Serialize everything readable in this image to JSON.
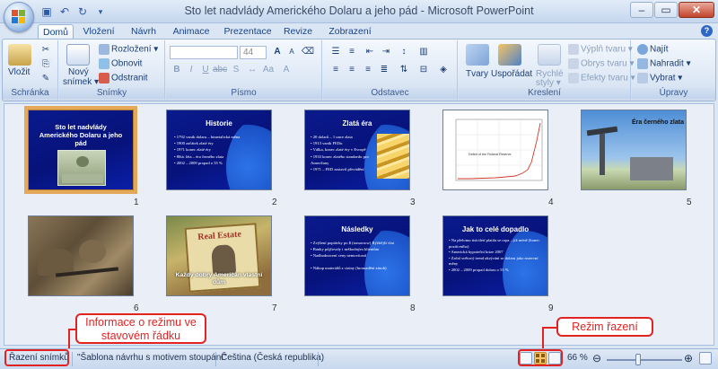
{
  "window": {
    "title": "Sto let nadvlády Amerického Dolaru a jeho pád - Microsoft PowerPoint"
  },
  "tabs": [
    {
      "label": "Domů",
      "active": true
    },
    {
      "label": "Vložení",
      "active": false
    },
    {
      "label": "Návrh",
      "active": false
    },
    {
      "label": "Animace",
      "active": false
    },
    {
      "label": "Prezentace",
      "active": false
    },
    {
      "label": "Revize",
      "active": false
    },
    {
      "label": "Zobrazení",
      "active": false
    }
  ],
  "ribbon": {
    "clipboard": {
      "label": "Schránka",
      "paste": "Vložit"
    },
    "slides": {
      "label": "Snímky",
      "new_slide_1": "Nový",
      "new_slide_2": "snímek ▾",
      "layout": "Rozložení ▾",
      "reset": "Obnovit",
      "delete": "Odstranit"
    },
    "font": {
      "label": "Písmo",
      "size": "44"
    },
    "paragraph": {
      "label": "Odstavec"
    },
    "drawing": {
      "label": "Kreslení",
      "shapes": "Tvary",
      "arrange": "Uspořádat",
      "quick_styles_1": "Rychlé",
      "quick_styles_2": "styly ▾",
      "shape_fill": "Výplň tvaru ▾",
      "shape_outline": "Obrys tvaru ▾",
      "shape_effects": "Efekty tvaru ▾"
    },
    "editing": {
      "label": "Úpravy",
      "find": "Najít",
      "replace": "Nahradit ▾",
      "select": "Vybrat ▾"
    }
  },
  "slides": [
    {
      "num": "1",
      "title": "Sto let nadvlády Amerického Dolaru a jeho pád",
      "selected": true
    },
    {
      "num": "2",
      "title": "Historie",
      "bullets": [
        "1792 vznik dolaru – bimetalická měna",
        "1900 začátek zlaté éry",
        "1971 konec zlaté éry",
        "80tá. léta – éra černého zlata",
        "2002 – 2009 propad o 55 %"
      ]
    },
    {
      "num": "3",
      "title": "Zlatá éra",
      "bullets": [
        "20 dolarů – 1 unce zlata",
        "1913 vznik FEDu",
        "Válka, konec zlaté éry v Evropě",
        "1933 konec zlatého standardu pro Američany",
        "1971 – FED zastavil převádění"
      ]
    },
    {
      "num": "4",
      "chart_caption": "Deficit of the Federal Reserve"
    },
    {
      "num": "5",
      "title": "Éra černého zlata"
    },
    {
      "num": "6"
    },
    {
      "num": "7",
      "title": "Každý dobrý Američan vlastní dům",
      "sign_text": "Real Estate"
    },
    {
      "num": "8",
      "title": "Následky",
      "bullets": [
        "Zvýšení poptávky po $ (tomorrow) Rýžitější vlni",
        "Banky půjčovaly i neškodným klientům",
        "Nadhodnocení ceny nemovitostí",
        "Nákup materiálů z ciziny (hromadění zásob)"
      ]
    },
    {
      "num": "9",
      "title": "Jak to celé dopadlo",
      "bullets": [
        "Na přelomu tisíciletí platila se ropa – již méně (konec pozitivního)",
        "Americká hypoteční krize 2007",
        "Začal světový trend ukrývání se dolaru jako rezervní měny",
        "2002 – 2009 propad dolaru o 55 %"
      ]
    }
  ],
  "statusbar": {
    "view": "Řazení snímků",
    "theme": "\"Šablona návrhu s motivem stoupání\"",
    "language": "Čeština (Česká republika)",
    "zoom": "66 %"
  },
  "annotations": {
    "status_note_1": "Informace o režimu ve",
    "status_note_2": "stavovém řádku",
    "sorter_note": "Režim řazení"
  },
  "colors": {
    "selected_border": "#e3a85a",
    "annotation": "#e32222",
    "slide_background": "#0a1a8c"
  }
}
